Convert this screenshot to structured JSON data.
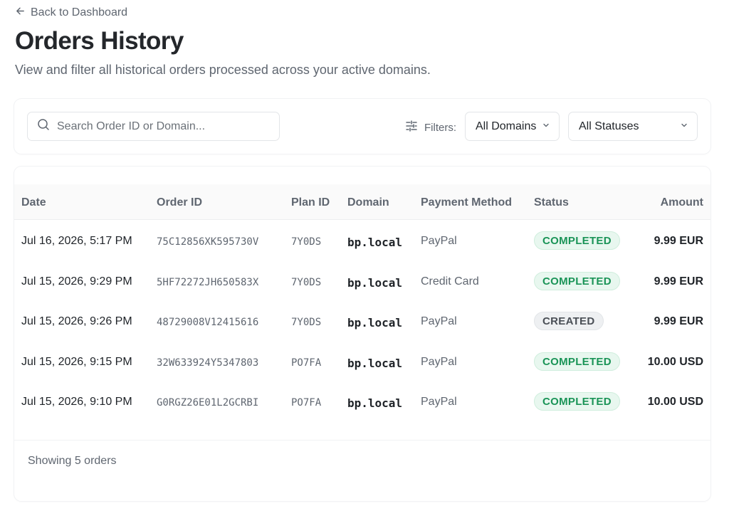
{
  "nav": {
    "back_label": "Back to Dashboard"
  },
  "header": {
    "title": "Orders History",
    "subtitle": "View and filter all historical orders processed across your active domains."
  },
  "filters": {
    "search_placeholder": "Search Order ID or Domain...",
    "filters_label": "Filters:",
    "domain_select": "All Domains",
    "status_select": "All Statuses"
  },
  "table": {
    "columns": [
      "Date",
      "Order ID",
      "Plan ID",
      "Domain",
      "Payment Method",
      "Status",
      "Amount"
    ],
    "rows": [
      {
        "date": "Jul 16, 2026, 5:17 PM",
        "order_id": "75C12856XK595730V",
        "plan_id": "7Y0DS",
        "domain": "bp.local",
        "payment": "PayPal",
        "status": "COMPLETED",
        "amount": "9.99 EUR"
      },
      {
        "date": "Jul 15, 2026, 9:29 PM",
        "order_id": "5HF72272JH650583X",
        "plan_id": "7Y0DS",
        "domain": "bp.local",
        "payment": "Credit Card",
        "status": "COMPLETED",
        "amount": "9.99 EUR"
      },
      {
        "date": "Jul 15, 2026, 9:26 PM",
        "order_id": "48729008V12415616",
        "plan_id": "7Y0DS",
        "domain": "bp.local",
        "payment": "PayPal",
        "status": "CREATED",
        "amount": "9.99 EUR"
      },
      {
        "date": "Jul 15, 2026, 9:15 PM",
        "order_id": "32W633924Y5347803",
        "plan_id": "PO7FA",
        "domain": "bp.local",
        "payment": "PayPal",
        "status": "COMPLETED",
        "amount": "10.00 USD"
      },
      {
        "date": "Jul 15, 2026, 9:10 PM",
        "order_id": "G0RGZ26E01L2GCRBI",
        "plan_id": "PO7FA",
        "domain": "bp.local",
        "payment": "PayPal",
        "status": "COMPLETED",
        "amount": "10.00 USD"
      }
    ],
    "footer": "Showing 5 orders"
  },
  "colors": {
    "completed_text": "#1a9457",
    "completed_bg": "#e8f7ef",
    "created_text": "#4a4f56",
    "created_bg": "#eef0f2"
  }
}
